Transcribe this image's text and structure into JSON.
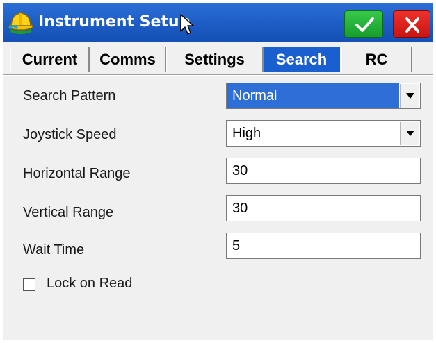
{
  "window": {
    "title": "Instrument Setup",
    "ok_icon": "checkmark-icon",
    "close_icon": "close-icon",
    "app_icon": "hard-hat-icon"
  },
  "tabs": [
    {
      "label": "Current",
      "active": false
    },
    {
      "label": "Comms",
      "active": false
    },
    {
      "label": "Settings",
      "active": false
    },
    {
      "label": "Search",
      "active": true
    },
    {
      "label": "RC",
      "active": false
    }
  ],
  "form": {
    "search_pattern": {
      "label": "Search Pattern",
      "value": "Normal"
    },
    "joystick_speed": {
      "label": "Joystick Speed",
      "value": "High"
    },
    "horizontal_range": {
      "label": "Horizontal Range",
      "value": "30"
    },
    "vertical_range": {
      "label": "Vertical Range",
      "value": "30"
    },
    "wait_time": {
      "label": "Wait Time",
      "value": "5"
    },
    "lock_on_read": {
      "label": "Lock on Read",
      "checked": false
    }
  },
  "colors": {
    "titlebar": "#1c5cc4",
    "active_tab": "#1a5fd0",
    "ok_button": "#1fa932",
    "close_button": "#d81a14",
    "selection": "#2d6fd6"
  }
}
